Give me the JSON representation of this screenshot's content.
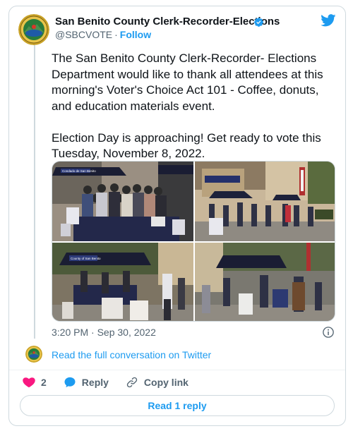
{
  "tweet": {
    "author_name": "San Benito County Clerk-Recorder-Elections",
    "handle": "@SBCVOTE",
    "separator": "·",
    "follow_label": "Follow",
    "text": "The San Benito County Clerk-Recorder- Elections Department would like to thank all attendees at this morning's Voter's Choice Act 101 - Coffee, donuts, and education materials event.\n\nElection Day is approaching! Get ready to vote this Tuesday, November 8, 2022.",
    "timestamp": "3:20 PM · Sep 30, 2022",
    "read_conversation": "Read the full conversation on Twitter",
    "like_count": "2",
    "reply_label": "Reply",
    "copy_link_label": "Copy link",
    "read_reply_label": "Read 1 reply"
  },
  "photos": {
    "banner_1": "Condado de San Benito",
    "banner_2": "County of San Benito"
  },
  "colors": {
    "accent": "#1d9bf0",
    "like": "#f91880",
    "text": "#0f1419",
    "muted": "#536471",
    "border": "#cfd9de"
  },
  "icons": [
    "county-seal-icon",
    "verified-badge-icon",
    "twitter-bird-icon",
    "info-icon",
    "heart-icon",
    "reply-bubble-icon",
    "link-icon"
  ]
}
